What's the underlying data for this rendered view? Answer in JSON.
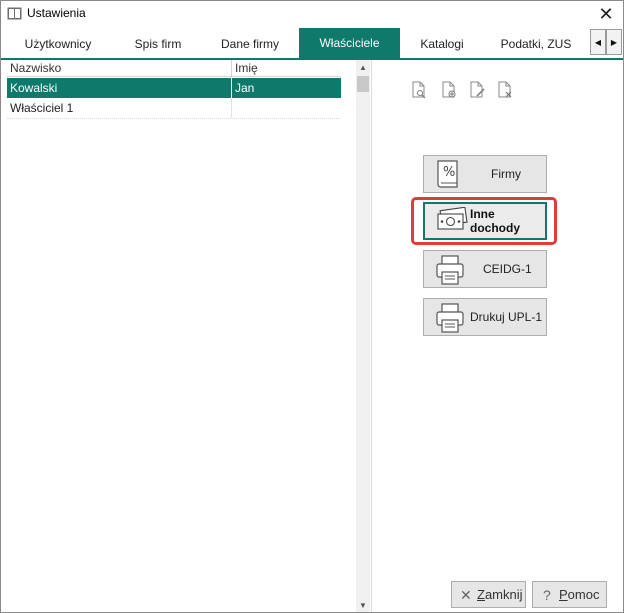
{
  "window": {
    "title": "Ustawienia"
  },
  "tabs": [
    {
      "label": "Użytkownicy"
    },
    {
      "label": "Spis firm"
    },
    {
      "label": "Dane firmy"
    },
    {
      "label": "Właściciele"
    },
    {
      "label": "Katalogi"
    },
    {
      "label": "Podatki, ZUS"
    }
  ],
  "active_tab": "Właściciele",
  "grid": {
    "columns": [
      "Nazwisko",
      "Imię"
    ],
    "rows": [
      {
        "nazwisko": "Kowalski",
        "imie": "Jan",
        "selected": true
      },
      {
        "nazwisko": "Właściciel 1",
        "imie": "",
        "selected": false
      }
    ]
  },
  "toolbar_icons": [
    "view-document-icon",
    "add-document-icon",
    "edit-document-icon",
    "delete-document-icon"
  ],
  "actions": {
    "firmy": "Firmy",
    "inne_dochody": "Inne dochody",
    "ceidg": "CEIDG-1",
    "drukuj_upl": "Drukuj UPL-1"
  },
  "footer": {
    "zamknij_first": "Z",
    "zamknij_rest": "amknij",
    "pomoc_first": "P",
    "pomoc_rest": "omoc"
  },
  "colors": {
    "accent": "#0f7a6c",
    "highlight": "#e03a3a"
  }
}
